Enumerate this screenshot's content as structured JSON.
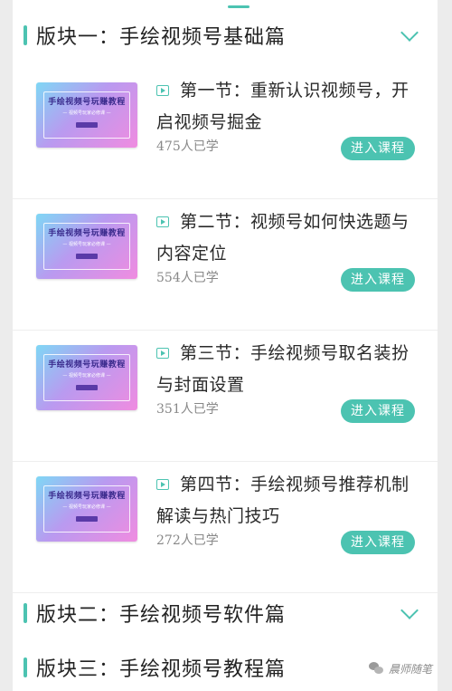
{
  "sections": [
    {
      "title": "版块一：手绘视频号基础篇"
    },
    {
      "title": "版块二：手绘视频号软件篇"
    },
    {
      "title": "版块三：手绘视频号教程篇"
    }
  ],
  "thumbnail": {
    "title": "手绘视频号玩赚教程",
    "subtitle": "— 视频号玩家必修课 —",
    "gradient_colors": [
      "#7fd7f5",
      "#b99af0",
      "#f08ce0"
    ]
  },
  "lessons": [
    {
      "title": "第一节：重新认识视频号，开启视频号掘金",
      "learners": "475人已学",
      "button": "进入课程"
    },
    {
      "title": "第二节：视频号如何快选题与内容定位",
      "learners": "554人已学",
      "button": "进入课程"
    },
    {
      "title": "第三节：手绘视频号取名装扮与封面设置",
      "learners": "351人已学",
      "button": "进入课程"
    },
    {
      "title": "第四节：手绘视频号推荐机制解读与热门技巧",
      "learners": "272人已学",
      "button": "进入课程"
    }
  ],
  "watermark": {
    "text": "晨师随笔",
    "icon": "wechat-icon"
  },
  "colors": {
    "accent": "#4cc3b1",
    "background": "#ececec",
    "panel": "#ffffff"
  }
}
